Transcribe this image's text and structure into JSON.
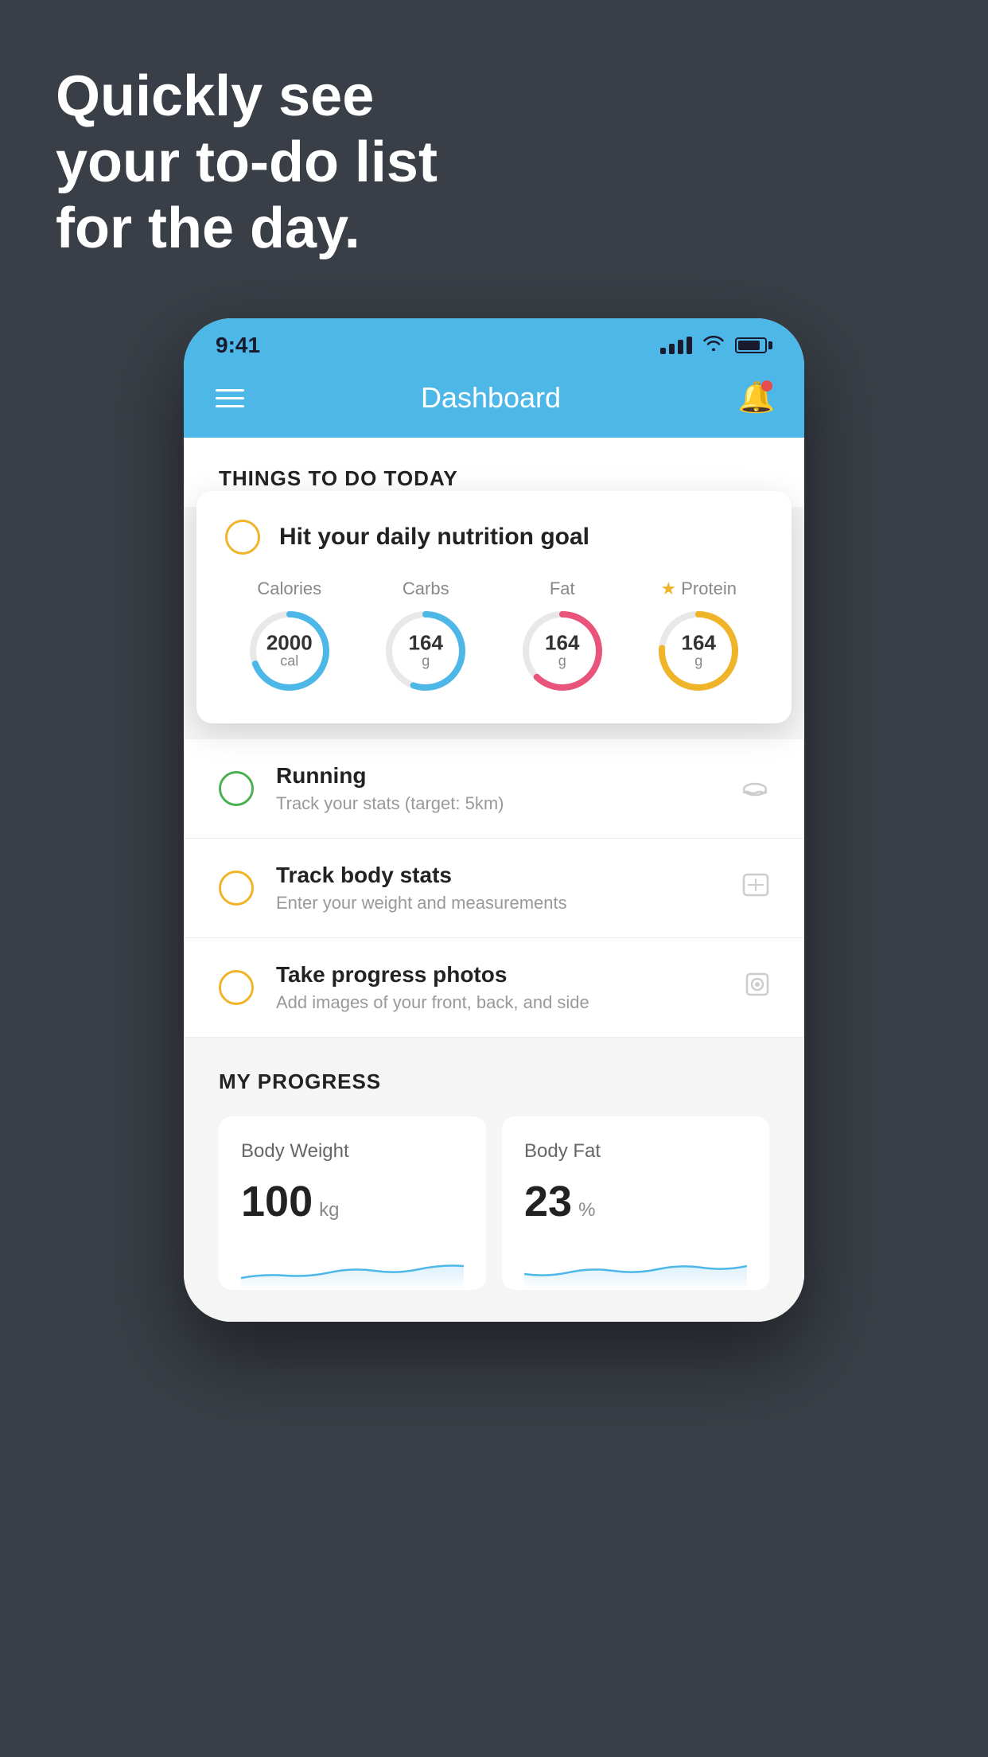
{
  "hero": {
    "line1": "Quickly see",
    "line2": "your to-do list",
    "line3": "for the day."
  },
  "status_bar": {
    "time": "9:41"
  },
  "header": {
    "title": "Dashboard"
  },
  "things_section": {
    "title": "THINGS TO DO TODAY"
  },
  "floating_card": {
    "title": "Hit your daily nutrition goal",
    "nutrition": [
      {
        "label": "Calories",
        "value": "2000",
        "unit": "cal",
        "color": "calories",
        "star": false
      },
      {
        "label": "Carbs",
        "value": "164",
        "unit": "g",
        "color": "carbs",
        "star": false
      },
      {
        "label": "Fat",
        "value": "164",
        "unit": "g",
        "color": "fat",
        "star": false
      },
      {
        "label": "Protein",
        "value": "164",
        "unit": "g",
        "color": "protein",
        "star": true
      }
    ]
  },
  "todo_items": [
    {
      "title": "Running",
      "subtitle": "Track your stats (target: 5km)",
      "circle_color": "green",
      "icon": "👟"
    },
    {
      "title": "Track body stats",
      "subtitle": "Enter your weight and measurements",
      "circle_color": "yellow",
      "icon": "⚖"
    },
    {
      "title": "Take progress photos",
      "subtitle": "Add images of your front, back, and side",
      "circle_color": "yellow",
      "icon": "👤"
    }
  ],
  "progress": {
    "title": "MY PROGRESS",
    "cards": [
      {
        "title": "Body Weight",
        "value": "100",
        "unit": "kg"
      },
      {
        "title": "Body Fat",
        "value": "23",
        "unit": "%"
      }
    ]
  }
}
